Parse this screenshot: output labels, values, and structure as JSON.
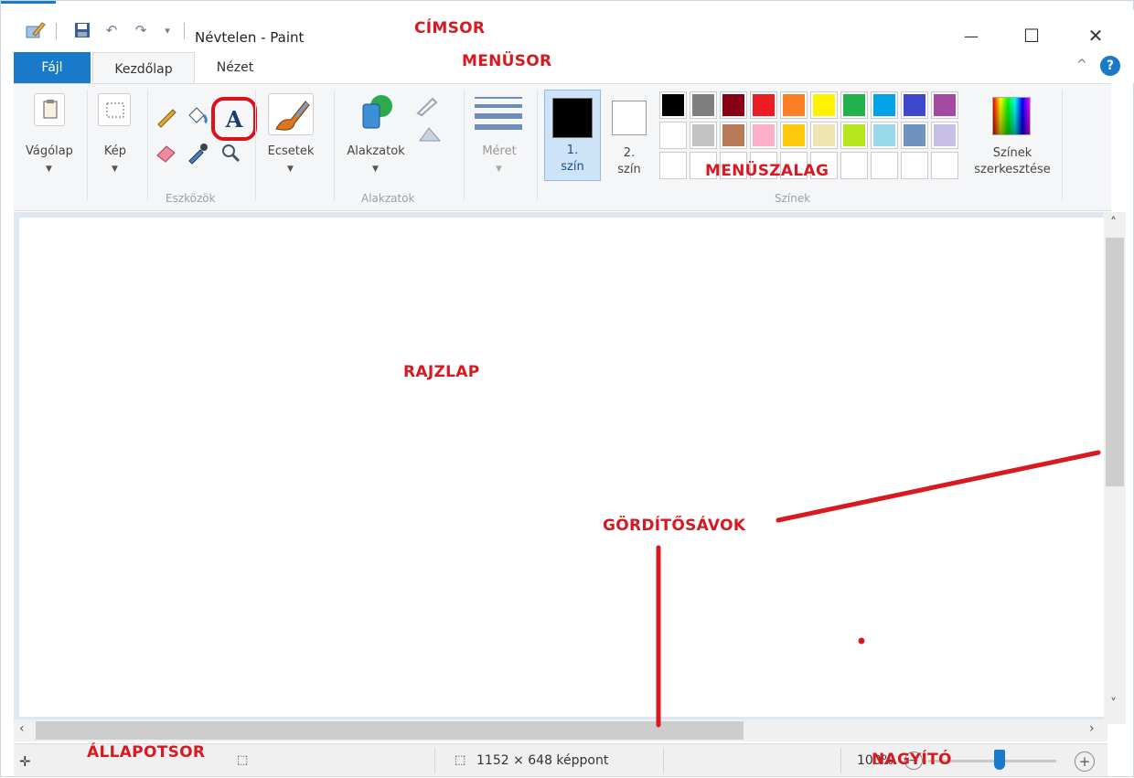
{
  "titlebar": {
    "title": "Névtelen - Paint",
    "minimize": "—",
    "maximize": "☐",
    "close": "✕"
  },
  "menu": {
    "file": "Fájl",
    "home": "Kezdőlap",
    "view": "Nézet",
    "collapse": "^",
    "help": "?"
  },
  "ribbon": {
    "clipboard": "Vágólap",
    "image": "Kép",
    "tools_group": "Eszközök",
    "brushes": "Ecsetek",
    "shapes": "Alakzatok",
    "shapes_group": "Alakzatok",
    "size": "Méret",
    "color1_line1": "1.",
    "color1_line2": "szín",
    "color2_line1": "2.",
    "color2_line2": "szín",
    "colors_group": "Színek",
    "edit_colors_line1": "Színek",
    "edit_colors_line2": "szerkesztése",
    "palette_row1": [
      "#000000",
      "#7f7f7f",
      "#880015",
      "#ed1c24",
      "#ff7f27",
      "#fff200",
      "#22b14c",
      "#00a2e8",
      "#3f48cc",
      "#a349a4"
    ],
    "palette_row2": [
      "#ffffff",
      "#c3c3c3",
      "#b97a57",
      "#ffaec9",
      "#ffc90e",
      "#efe4b0",
      "#b5e61d",
      "#99d9ea",
      "#7092be",
      "#c8bfe7"
    ]
  },
  "status": {
    "canvas_size": "1152 × 648 képpont",
    "zoom": "100%"
  },
  "annotations": {
    "titlebar": "CÍMSOR",
    "menubar": "MENÜSOR",
    "ribbon": "MENÜSZALAG",
    "canvas": "RAJZLAP",
    "scrollbars": "GÖRDÍTŐSÁVOK",
    "statusbar": "ÁLLAPOTSOR",
    "zoom": "NAGYÍTÓ"
  },
  "colors": {
    "accent": "#1979ca",
    "annotation": "#d9191f",
    "ribbon_bg": "#f5f6f7"
  }
}
